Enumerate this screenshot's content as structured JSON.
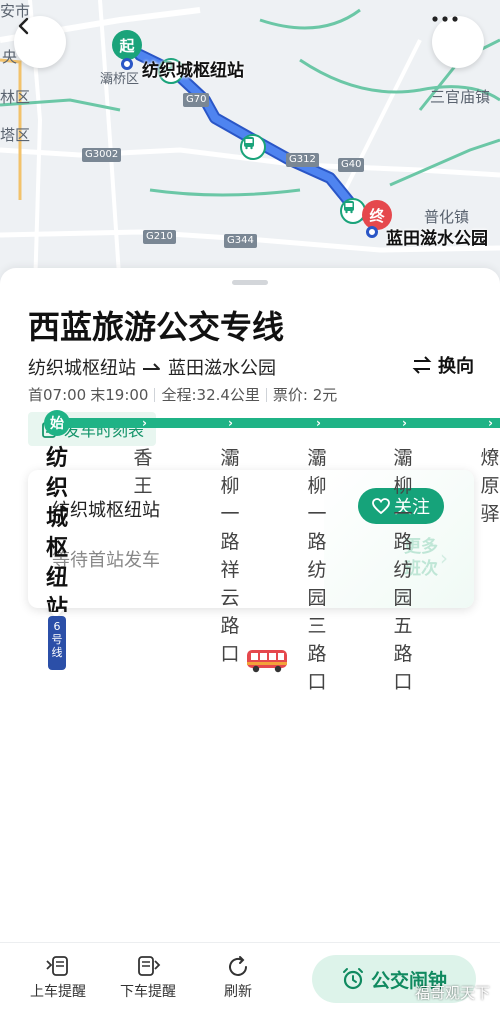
{
  "map": {
    "labels": [
      "安市",
      "央",
      "林区",
      "塔区",
      "灞桥区",
      "三官庙镇",
      "普化镇"
    ],
    "shields": [
      "G70",
      "G3002",
      "G312",
      "G40",
      "G210",
      "G344"
    ],
    "start_marker": "起",
    "end_marker": "终",
    "start_stop": "纺织城枢纽站",
    "end_stop": "蓝田滋水公园"
  },
  "header": {
    "back_icon": "chevron-left-icon",
    "more_icon": "more-dots-icon"
  },
  "route": {
    "title": "西蓝旅游公交专线",
    "from": "纺织城枢纽站",
    "to": "蓝田滋水公园",
    "reverse_label": "换向",
    "first_bus": "首07:00",
    "last_bus": "末19:00",
    "distance": "全程:32.4公里",
    "fare": "票价: 2元",
    "timetable_label": "发车时刻表"
  },
  "status_card": {
    "station": "纺织城枢纽站",
    "waiting": "等待首站发车",
    "follow_label": "关注",
    "more_line1": "更多",
    "more_line2": "班次"
  },
  "stations": {
    "start_badge": "始",
    "line_badge_num": "6",
    "line_badge_text": "号线",
    "list": [
      "纺织城枢纽站",
      "香王",
      "灞柳一路祥云路口",
      "灞柳一路纺园三路口",
      "灞柳一路纺园五路口",
      "燎原驿"
    ]
  },
  "bottom_bar": {
    "board_alert": "上车提醒",
    "alight_alert": "下车提醒",
    "refresh": "刷新",
    "alarm": "公交闹钟"
  },
  "watermark": "福哥观天下",
  "colors": {
    "accent": "#1fb386",
    "route_line": "#3d6fe0",
    "start": "#1aa37a",
    "end": "#e5484d"
  }
}
